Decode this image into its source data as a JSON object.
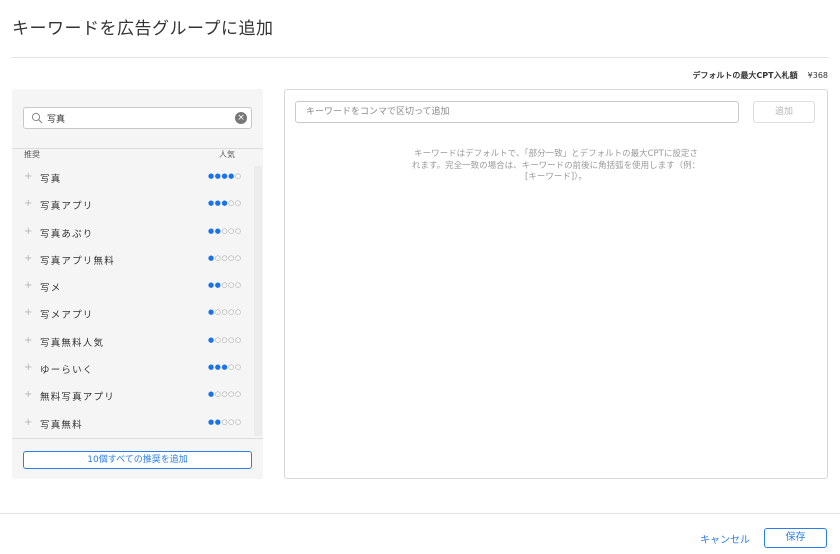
{
  "dialog": {
    "title": "キーワードを広告グループに追加"
  },
  "max_bid": {
    "label": "デフォルトの最大CPT入札額",
    "value": "¥368"
  },
  "search": {
    "value": "写真",
    "icon": "search-icon",
    "clear_icon": "clear-icon"
  },
  "suggestions": {
    "header_recommend": "推奨",
    "header_popularity": "人気",
    "add_all_label": "10個すべての推奨を追加",
    "items": [
      {
        "keyword": "写真",
        "popularity": 4,
        "max": 5
      },
      {
        "keyword": "写真アプリ",
        "popularity": 3,
        "max": 5
      },
      {
        "keyword": "写真あぷり",
        "popularity": 2,
        "max": 5
      },
      {
        "keyword": "写真アプリ無料",
        "popularity": 1,
        "max": 5
      },
      {
        "keyword": "写メ",
        "popularity": 2,
        "max": 5
      },
      {
        "keyword": "写メアプリ",
        "popularity": 1,
        "max": 5
      },
      {
        "keyword": "写真無料人気",
        "popularity": 1,
        "max": 5
      },
      {
        "keyword": "ゆーらいく",
        "popularity": 3,
        "max": 5
      },
      {
        "keyword": "無料写真アプリ",
        "popularity": 1,
        "max": 5
      },
      {
        "keyword": "写真無料",
        "popularity": 2,
        "max": 5
      }
    ]
  },
  "keyword_entry": {
    "placeholder": "キーワードをコンマで区切って追加",
    "add_label": "追加",
    "hint": "キーワードはデフォルトで、「部分一致」とデフォルトの最大CPTに設定されます。完全一致の場合は、キーワードの前後に角括弧を使用します（例：[キーワード]）。"
  },
  "footer": {
    "cancel_label": "キャンセル",
    "save_label": "保存"
  },
  "colors": {
    "accent": "#2b7de9",
    "dot_on": "#1a73e8",
    "dot_off": "#9a9a9a"
  }
}
